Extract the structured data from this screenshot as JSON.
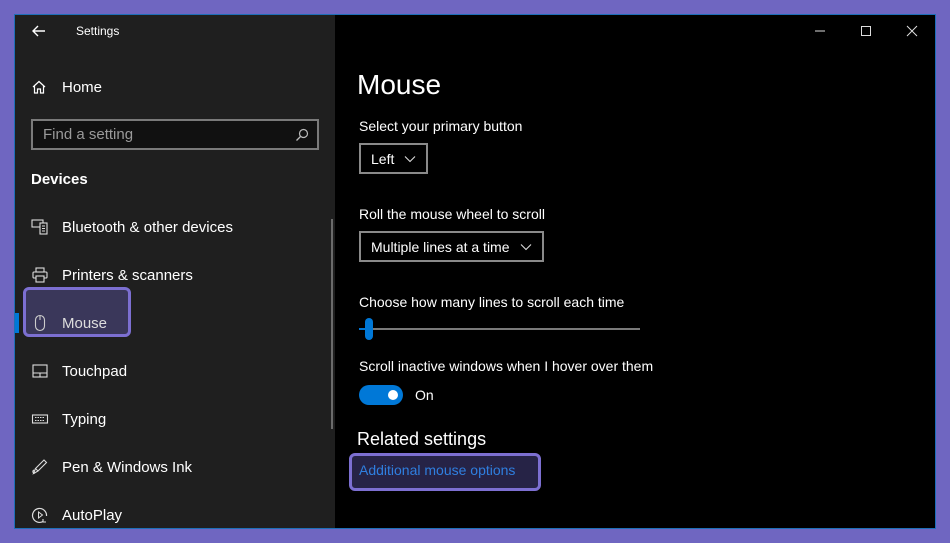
{
  "window": {
    "title": "Settings",
    "controls": {
      "minimize": "minimize-icon",
      "maximize": "maximize-icon",
      "close": "close-icon"
    }
  },
  "sidebar": {
    "back_icon": "back-arrow-icon",
    "home": {
      "label": "Home",
      "icon": "home-icon"
    },
    "search": {
      "placeholder": "Find a setting",
      "value": "",
      "icon": "search-icon"
    },
    "section_heading": "Devices",
    "items": [
      {
        "label": "Bluetooth & other devices",
        "icon": "bluetooth-devices-icon",
        "active": false
      },
      {
        "label": "Printers & scanners",
        "icon": "printer-icon",
        "active": false
      },
      {
        "label": "Mouse",
        "icon": "mouse-icon",
        "active": true
      },
      {
        "label": "Touchpad",
        "icon": "touchpad-icon",
        "active": false
      },
      {
        "label": "Typing",
        "icon": "keyboard-icon",
        "active": false
      },
      {
        "label": "Pen & Windows Ink",
        "icon": "pen-icon",
        "active": false
      },
      {
        "label": "AutoPlay",
        "icon": "autoplay-icon",
        "active": false
      }
    ]
  },
  "main": {
    "title": "Mouse",
    "primary_button": {
      "label": "Select your primary button",
      "selected": "Left"
    },
    "wheel_scroll": {
      "label": "Roll the mouse wheel to scroll",
      "selected": "Multiple lines at a time"
    },
    "lines_slider": {
      "label": "Choose how many lines to scroll each time",
      "min": 1,
      "max": 100,
      "value": 3
    },
    "inactive_scroll": {
      "label": "Scroll inactive windows when I hover over them",
      "state": "On",
      "enabled": true
    },
    "related": {
      "heading": "Related settings",
      "link": "Additional mouse options"
    }
  },
  "colors": {
    "accent": "#0078d7",
    "link": "#2f7fe0",
    "highlight": "#7c6fd1",
    "frame": "#6f66c1",
    "sidebar_bg": "#1f1f1f",
    "main_bg": "#000000"
  }
}
